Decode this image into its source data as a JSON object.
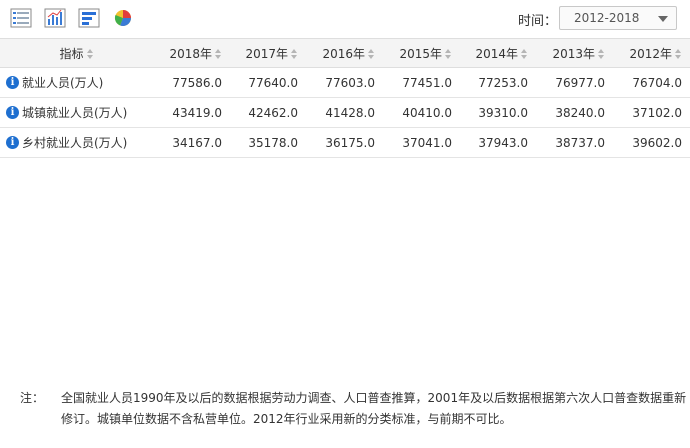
{
  "toolbar": {
    "icons": [
      "table-view-icon",
      "bar-chart-icon",
      "horizontal-bar-icon",
      "pie-chart-icon"
    ],
    "time_label": "时间：",
    "time_value": "2012-2018"
  },
  "table": {
    "indicator_header": "指标",
    "years": [
      "2018年",
      "2017年",
      "2016年",
      "2015年",
      "2014年",
      "2013年",
      "2012年"
    ],
    "rows": [
      {
        "name": "就业人员(万人)",
        "values": [
          "77586.0",
          "77640.0",
          "77603.0",
          "77451.0",
          "77253.0",
          "76977.0",
          "76704.0"
        ]
      },
      {
        "name": "城镇就业人员(万人)",
        "values": [
          "43419.0",
          "42462.0",
          "41428.0",
          "40410.0",
          "39310.0",
          "38240.0",
          "37102.0"
        ]
      },
      {
        "name": "乡村就业人员(万人)",
        "values": [
          "34167.0",
          "35178.0",
          "36175.0",
          "37041.0",
          "37943.0",
          "38737.0",
          "39602.0"
        ]
      }
    ],
    "info_glyph": "i"
  },
  "note": {
    "label": "注：",
    "text": "全国就业人员1990年及以后的数据根据劳动力调查、人口普查推算，2001年及以后数据根据第六次人口普查数据重新修订。城镇单位数据不含私营单位。2012年行业采用新的分类标准，与前期不可比。"
  },
  "colors": {
    "header_bg": "#f4f4f4",
    "info_blue": "#1e6fd0",
    "border": "#dedede"
  }
}
